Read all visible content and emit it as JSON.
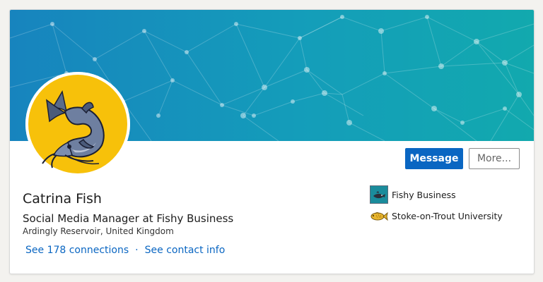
{
  "profile": {
    "name": "Catrina Fish",
    "headline": "Social Media Manager at Fishy Business",
    "location": "Ardingly Reservoir, United Kingdom"
  },
  "actions": {
    "message_label": "Message",
    "more_label": "More..."
  },
  "links": {
    "connections": "See 178 connections",
    "separator": "·",
    "contact_info": "See contact info"
  },
  "side": {
    "items": [
      {
        "label": "Fishy Business",
        "icon": "company-logo-icon"
      },
      {
        "label": "Stoke-on-Trout University",
        "icon": "fish-logo-icon"
      }
    ]
  },
  "colors": {
    "accent": "#0a66c2",
    "banner_start": "#1387c0",
    "banner_end": "#13a6b0",
    "avatar_bg": "#f7c10a"
  }
}
